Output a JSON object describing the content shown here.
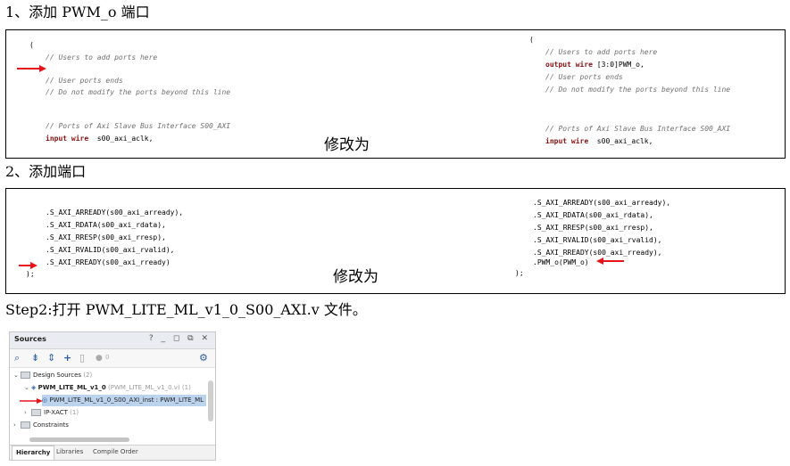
{
  "section1": {
    "heading": "1、添加 PWM_o 端口",
    "before": {
      "paren": "(",
      "comment_add": "// Users to add ports here",
      "comment_end": "// User ports ends",
      "comment_nomod": "// Do not modify the ports beyond this line",
      "comment_axi": "// Ports of Axi Slave Bus Interface S00_AXI",
      "input_kw": "input wire",
      "input_sig": "  s00_axi_aclk,"
    },
    "change_label": "修改为",
    "after": {
      "paren": "(",
      "comment_add": "// Users to add ports here",
      "output_kw": "output wire",
      "output_sig": " [3:0]PWM_o,",
      "comment_end": "// User ports ends",
      "comment_nomod": "// Do not modify the ports beyond this line",
      "comment_axi": "// Ports of Axi Slave Bus Interface S00_AXI",
      "input_kw": "input wire",
      "input_sig": "  s00_axi_aclk,"
    }
  },
  "section2": {
    "heading": "2、添加端口",
    "before": {
      "lines": [
        ".S_AXI_ARREADY(s00_axi_arready),",
        ".S_AXI_RDATA(s00_axi_rdata),",
        ".S_AXI_RRESP(s00_axi_rresp),",
        ".S_AXI_RVALID(s00_axi_rvalid),",
        ".S_AXI_RREADY(s00_axi_rready)"
      ],
      "close": ");"
    },
    "change_label": "修改为",
    "after": {
      "lines": [
        ".S_AXI_ARREADY(s00_axi_arready),",
        ".S_AXI_RDATA(s00_axi_rdata),",
        ".S_AXI_RRESP(s00_axi_rresp),",
        ".S_AXI_RVALID(s00_axi_rvalid),",
        ".S_AXI_RREADY(s00_axi_rready),",
        ".PWM_o(PWM_o)"
      ],
      "close": ");"
    }
  },
  "step2": {
    "heading": "Step2:打开 PWM_LITE_ML_v1_0_S00_AXI.v 文件。"
  },
  "sources_panel": {
    "title": "Sources",
    "controls": "? _ ◻ ⧉ ✕",
    "badge_count": "0",
    "tree": {
      "design_sources": "Design Sources",
      "design_sources_count": "(2)",
      "top_module": "PWM_LITE_ML_v1_0",
      "top_module_file": "(PWM_LITE_ML_v1_0.v) (1)",
      "instance": "PWM_LITE_ML_v1_0_S00_AXI_inst : PWM_LITE_ML",
      "ip_xact": "IP-XACT",
      "ip_xact_count": "(1)",
      "constraints": "Constraints"
    },
    "tabs": [
      "Hierarchy",
      "Libraries",
      "Compile Order"
    ]
  },
  "colors": {
    "arrow": "#e8141b",
    "comment": "#707070",
    "keyword": "#8a1010",
    "selection": "#bcd3ee",
    "toolbar_icon": "#2b5fa8"
  }
}
